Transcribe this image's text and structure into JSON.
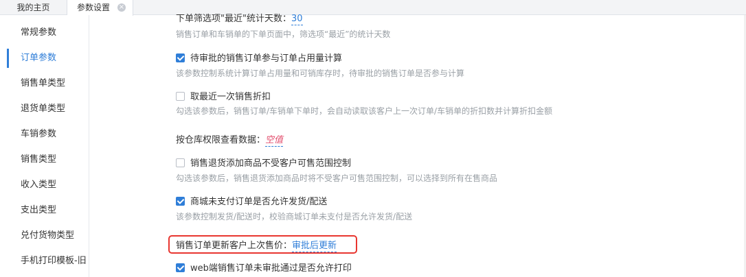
{
  "tabs": [
    {
      "label": "我的主页"
    },
    {
      "label": "参数设置",
      "close": "×"
    }
  ],
  "sidebar": {
    "items": [
      {
        "label": "常规参数"
      },
      {
        "label": "订单参数"
      },
      {
        "label": "销售单类型"
      },
      {
        "label": "退货单类型"
      },
      {
        "label": "车销参数"
      },
      {
        "label": "销售类型"
      },
      {
        "label": "收入类型"
      },
      {
        "label": "支出类型"
      },
      {
        "label": "兑付货物类型"
      },
      {
        "label": "手机打印模板-旧"
      }
    ],
    "active_index": 1
  },
  "main": {
    "top_partial": {
      "label": "下单筛选项\"最近\"统计天数：",
      "value": "30"
    },
    "top_partial_desc": "销售订单和车销单的下单页面中，筛选项“最近”的统计天数",
    "settings": [
      {
        "label": "待审批的销售订单参与订单占用量计算",
        "checked": true,
        "desc": "该参数控制系统计算订单占用量和可销库存时，待审批的销售订单是否参与计算"
      },
      {
        "label": "取最近一次销售折扣",
        "checked": false,
        "desc": "勾选该参数后，销售订单/车销单下单时，会自动读取该客户上一次订单/车销单的折扣数并计算折扣金额"
      },
      {
        "label": "销售退货添加商品不受客户可售范围控制",
        "checked": false,
        "desc": "勾选该参数后，销售退货添加商品时将不受客户可售范围控制，可以选择到所有在售商品"
      },
      {
        "label": "商城未支付订单是否允许发货/配送",
        "checked": true,
        "desc": "该参数控制发货/配送时，校验商城订单未支付是否允许发货/配送"
      },
      {
        "label": "web端销售订单未审批通过是否允许打印",
        "checked": true
      }
    ],
    "warehouse_view": {
      "label": "按仓库权限查看数据：",
      "value": "空值"
    },
    "last_price": {
      "label": "销售订单更新客户上次售价：",
      "value": "审批后更新"
    }
  },
  "colors": {
    "accent": "#2f7ed8",
    "highlight": "#e8352f",
    "empty_value": "#e24a6a"
  }
}
